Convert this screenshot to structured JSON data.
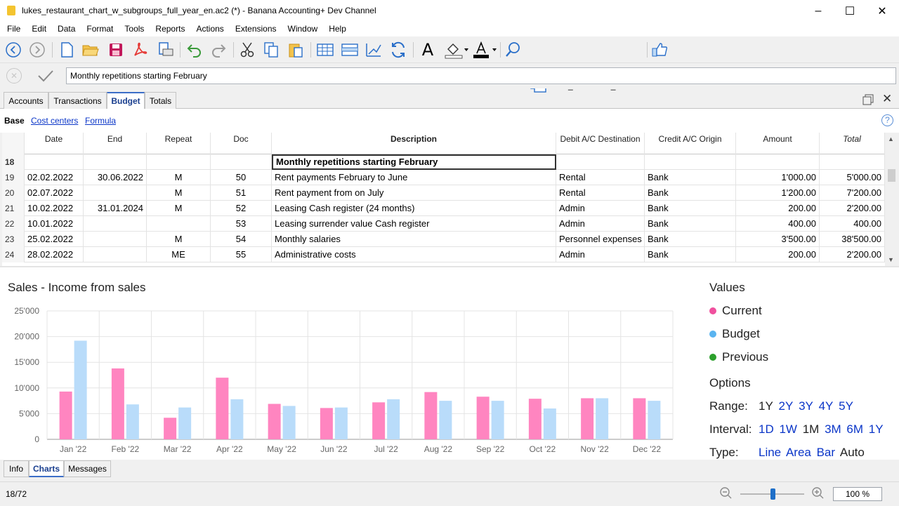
{
  "window": {
    "title": "lukes_restaurant_chart_w_subgroups_full_year_en.ac2 (*) - Banana Accounting+ Dev Channel"
  },
  "menu": [
    "File",
    "Edit",
    "Data",
    "Format",
    "Tools",
    "Reports",
    "Actions",
    "Extensions",
    "Window",
    "Help"
  ],
  "toolbar": {
    "file_selector": "lukes_restaurant_cha..."
  },
  "edit_line": {
    "value": "Monthly repetitions starting February"
  },
  "tabs": [
    "Accounts",
    "Transactions",
    "Budget",
    "Totals"
  ],
  "active_tab": "Budget",
  "views": {
    "base": "Base",
    "cost_centers": "Cost centers",
    "formula": "Formula"
  },
  "table": {
    "headers": {
      "date": "Date",
      "end": "End",
      "repeat": "Repeat",
      "doc": "Doc",
      "description": "Description",
      "debit": "Debit A/C  Destination",
      "credit": "Credit A/C  Origin",
      "amount": "Amount",
      "total": "Total"
    },
    "rows": [
      {
        "num": "18",
        "date": "",
        "end": "",
        "repeat": "",
        "doc": "",
        "description": "Monthly repetitions starting February",
        "debit": "",
        "credit": "",
        "amount": "",
        "total": ""
      },
      {
        "num": "19",
        "date": "02.02.2022",
        "end": "30.06.2022",
        "repeat": "M",
        "doc": "50",
        "description": "Rent payments February to June",
        "debit": "Rental",
        "credit": "Bank",
        "amount": "1'000.00",
        "total": "5'000.00"
      },
      {
        "num": "20",
        "date": "02.07.2022",
        "end": "",
        "repeat": "M",
        "doc": "51",
        "description": "Rent payment from on July",
        "debit": "Rental",
        "credit": "Bank",
        "amount": "1'200.00",
        "total": "7'200.00"
      },
      {
        "num": "21",
        "date": "10.02.2022",
        "end": "31.01.2024",
        "repeat": "M",
        "doc": "52",
        "description": "Leasing Cash register (24 months)",
        "debit": "Admin",
        "credit": "Bank",
        "amount": "200.00",
        "total": "2'200.00"
      },
      {
        "num": "22",
        "date": "10.01.2022",
        "end": "",
        "repeat": "",
        "doc": "53",
        "description": "Leasing surrender value Cash register",
        "debit": "Admin",
        "credit": "Bank",
        "amount": "400.00",
        "total": "400.00"
      },
      {
        "num": "23",
        "date": "25.02.2022",
        "end": "",
        "repeat": "M",
        "doc": "54",
        "description": "Monthly salaries",
        "debit": "Personnel expenses",
        "credit": "Bank",
        "amount": "3'500.00",
        "total": "38'500.00"
      },
      {
        "num": "24",
        "date": "28.02.2022",
        "end": "",
        "repeat": "ME",
        "doc": "55",
        "description": "Administrative costs",
        "debit": "Admin",
        "credit": "Bank",
        "amount": "200.00",
        "total": "2'200.00"
      }
    ]
  },
  "chart_panel": {
    "title": "Sales - Income from sales",
    "values_heading": "Values",
    "legend": [
      {
        "label": "Current",
        "color": "#f0509e"
      },
      {
        "label": "Budget",
        "color": "#5ab4f0"
      },
      {
        "label": "Previous",
        "color": "#2ca02c"
      }
    ],
    "options_heading": "Options",
    "range_label": "Range:",
    "range_options": [
      "1Y",
      "2Y",
      "3Y",
      "4Y",
      "5Y"
    ],
    "range_selected": "1Y",
    "interval_label": "Interval:",
    "interval_options": [
      "1D",
      "1W",
      "1M",
      "3M",
      "6M",
      "1Y"
    ],
    "interval_selected": "1M",
    "type_label": "Type:",
    "type_options": [
      "Line",
      "Area",
      "Bar",
      "Auto"
    ],
    "type_selected": "Auto"
  },
  "chart_data": {
    "type": "bar",
    "categories": [
      "Jan '22",
      "Feb '22",
      "Mar '22",
      "Apr '22",
      "May '22",
      "Jun '22",
      "Jul '22",
      "Aug '22",
      "Sep '22",
      "Oct '22",
      "Nov '22",
      "Dec '22"
    ],
    "series": [
      {
        "name": "Current",
        "color": "#ff85c0",
        "values": [
          9300,
          13800,
          4200,
          12000,
          6900,
          6100,
          7200,
          9200,
          8300,
          7900,
          8000,
          8000
        ]
      },
      {
        "name": "Budget",
        "color": "#b9dcfa",
        "values": [
          19200,
          6800,
          6200,
          7800,
          6500,
          6200,
          7800,
          7500,
          7500,
          6000,
          8000,
          7500
        ]
      }
    ],
    "ylim": [
      0,
      25000
    ],
    "yticks": [
      "0",
      "5'000",
      "10'000",
      "15'000",
      "20'000",
      "25'000"
    ],
    "grid": true
  },
  "bottom_tabs": [
    "Info",
    "Charts",
    "Messages"
  ],
  "active_bottom_tab": "Charts",
  "status": {
    "position": "18/72",
    "zoom": "100 %"
  }
}
